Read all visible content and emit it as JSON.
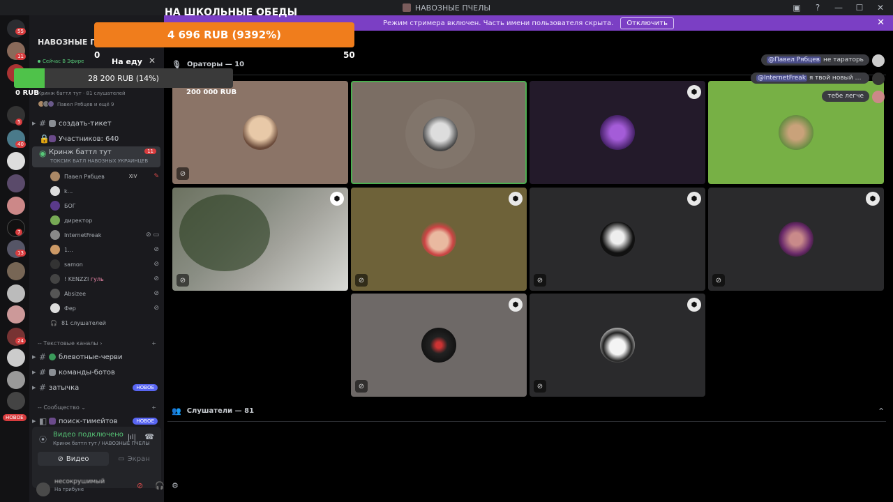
{
  "window": {
    "title": "НАВОЗНЫЕ ПЧЕЛЫ"
  },
  "banner": {
    "text": "Режим стримера включен. Часть имени пользователя скрыта.",
    "button": "Отключить"
  },
  "rail": {
    "badges": [
      "55",
      "11",
      "5",
      "40",
      "7",
      "13",
      "24"
    ],
    "new_label": "НОВОЕ"
  },
  "donation": {
    "title": "НА ШКОЛЬНЫЕ ОБЕДЫ",
    "amount": "4 696 RUB (9392%)",
    "min": "0",
    "max": "50",
    "progress": 9392
  },
  "food_goal": {
    "title": "На еду",
    "amount": "28 200 RUB (14%)",
    "min": "0 RUB",
    "max": "200 000 RUB",
    "progress": 0.14
  },
  "sidebar": {
    "server_name": "НАВОЗНЫЕ П",
    "live_label": "Сейчас В Эфире",
    "stage_info": "Кринж баттл тут · 81 слушателей",
    "stage_speakers": "Павел Рябцев и ещё 9",
    "channels": {
      "ticket": "создать-тикет",
      "members": "Участников: 640",
      "stage_name": "Кринж баттл тут",
      "stage_count": "11",
      "stage_topic": "ТОКСИК БАТЛ НАВОЗНЫХ УКРАИНЦЕВ"
    },
    "members": [
      {
        "name": "Павел Рябцев",
        "tag": "XIV"
      },
      {
        "name": "k..."
      },
      {
        "name": "БОГ"
      },
      {
        "name": "директор"
      },
      {
        "name": "InternetFreak"
      },
      {
        "name": "1..."
      },
      {
        "name": "samon"
      },
      {
        "name": "! KENZZI",
        "tag": "гуль"
      },
      {
        "name": "Absizee"
      },
      {
        "name": "Фер"
      }
    ],
    "listeners": "81 слушателей",
    "text_category": "Текстовые каналы",
    "text_channels": [
      "блевотные-черви",
      "команды-ботов",
      "затычка"
    ],
    "new_tag": "НОВОЕ",
    "community_category": "Сообщество",
    "community_channels": [
      "поиск-тимейтов"
    ]
  },
  "voice": {
    "status": "Видео подключено",
    "sub": "Кринж баттл тут / НАВОЗНЫЕ ПЧЕЛЫ",
    "video_btn": "Видео",
    "screen_btn": "Экран"
  },
  "user": {
    "name": "несокрушимый",
    "status": "На трибуне"
  },
  "stage": {
    "speakers_header": "Ораторы — 10",
    "listeners_header": "Слушатели — 81"
  },
  "chat": [
    {
      "mention": "@Павел Рябцев",
      "text": " не тараторь"
    },
    {
      "mention": "@InternetFreak",
      "text": " я твой новый ф..."
    },
    {
      "mention": "",
      "text": "тебе легче"
    }
  ],
  "colors": {
    "accent": "#7b3fc4",
    "donation": "#f07d1c",
    "goal_fill": "#4fc24a",
    "speaking": "#4caf50"
  },
  "icons": [
    "discord-icon",
    "mic-icon",
    "mic-muted-icon",
    "moderator-shield-icon",
    "headphones-icon",
    "settings-icon",
    "hangup-icon",
    "chevron-up-icon"
  ]
}
